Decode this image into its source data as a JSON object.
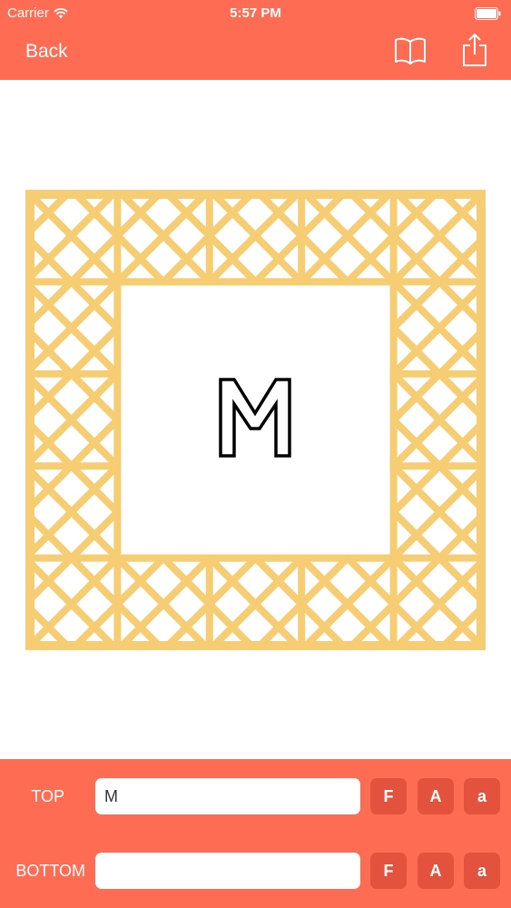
{
  "status_bar": {
    "carrier": "Carrier",
    "time": "5:57 PM"
  },
  "nav": {
    "back_label": "Back",
    "left_icon": "book-icon",
    "right_icon": "share-icon"
  },
  "monogram": {
    "letter": "M",
    "frame_color": "#f7cd73"
  },
  "colors": {
    "accent": "#fe6c54",
    "button": "#e2523d"
  },
  "toolbar": {
    "rows": [
      {
        "label": "TOP",
        "value": "M",
        "buttons": [
          "F",
          "A",
          "a"
        ]
      },
      {
        "label": "BOTTOM",
        "value": "",
        "buttons": [
          "F",
          "A",
          "a"
        ]
      }
    ]
  }
}
